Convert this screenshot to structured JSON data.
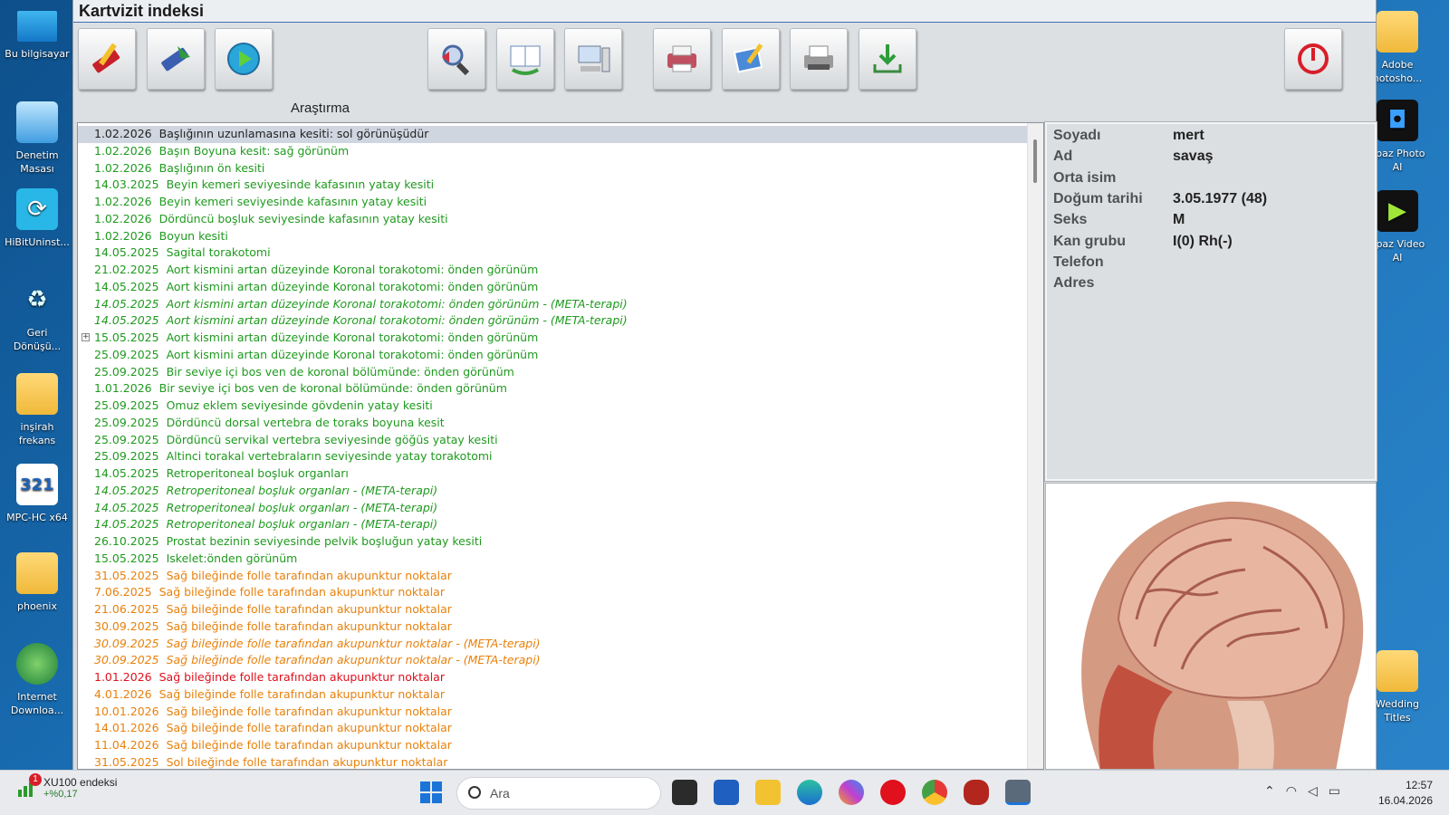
{
  "desktop": {
    "left_icons": [
      {
        "label": "Bu bilgisayar",
        "icon": "monitor-icon"
      },
      {
        "label": "Denetim\nMasası",
        "icon": "control-panel-icon"
      },
      {
        "label": "HiBitUninst...",
        "icon": "uninstaller-icon"
      },
      {
        "label": "Geri\nDönüşü...",
        "icon": "recycle-bin-icon"
      },
      {
        "label": "inşirah\nfrekans",
        "icon": "folder-icon"
      },
      {
        "label": "MPC-HC x64",
        "icon": "media-player-icon"
      },
      {
        "label": "phoenix",
        "icon": "folder-user-icon"
      },
      {
        "label": "Internet\nDownloa...",
        "icon": "downloader-icon"
      }
    ],
    "right_icons": [
      {
        "label": "Adobe\nhotosho...",
        "icon": "folder-photoshop-icon"
      },
      {
        "label": "opaz Photo\nAI",
        "icon": "topaz-photo-icon"
      },
      {
        "label": "opaz Video\nAI",
        "icon": "topaz-video-icon"
      },
      {
        "label": "Wedding\nTitles",
        "icon": "folder-ae-icon"
      }
    ]
  },
  "app": {
    "title": "Kartvizit indeksi",
    "toolbar": {
      "buttons": [
        {
          "name": "edit-button",
          "icon": "pencil-ruler-icon"
        },
        {
          "name": "tools-button",
          "icon": "tools-arrow-icon"
        },
        {
          "name": "research-button",
          "icon": "play-circle-icon"
        },
        {
          "name": "search-button",
          "icon": "magnifier-icon"
        },
        {
          "name": "compare-button",
          "icon": "documents-icon"
        },
        {
          "name": "computer-button",
          "icon": "computer-icon"
        },
        {
          "name": "print-button",
          "icon": "printer-icon"
        },
        {
          "name": "edit-image-button",
          "icon": "image-edit-icon"
        },
        {
          "name": "fax-button",
          "icon": "fax-icon"
        },
        {
          "name": "export-button",
          "icon": "download-tray-icon"
        },
        {
          "name": "power-button",
          "icon": "power-icon"
        }
      ],
      "tooltip": "Araştırma"
    },
    "records": [
      {
        "date": "1.02.2026",
        "text": "Başlığının uzunlamasına kesiti: sol görünüşüdür",
        "color": "selected",
        "italic": false
      },
      {
        "date": "1.02.2026",
        "text": "Başın Boyuna kesit: sağ görünüm",
        "color": "green",
        "italic": false
      },
      {
        "date": "1.02.2026",
        "text": "Başlığının ön kesiti",
        "color": "green",
        "italic": false
      },
      {
        "date": "14.03.2025",
        "text": "Beyin kemeri seviyesinde kafasının yatay kesiti",
        "color": "green",
        "italic": false
      },
      {
        "date": "1.02.2026",
        "text": "Beyin kemeri seviyesinde kafasının yatay kesiti",
        "color": "green",
        "italic": false
      },
      {
        "date": "1.02.2026",
        "text": "Dördüncü boşluk seviyesinde kafasının yatay kesiti",
        "color": "green",
        "italic": false
      },
      {
        "date": "1.02.2026",
        "text": "Boyun kesiti",
        "color": "green",
        "italic": false
      },
      {
        "date": "14.05.2025",
        "text": "Sagital torakotomi",
        "color": "green",
        "italic": false
      },
      {
        "date": "21.02.2025",
        "text": "Aort kismini artan düzeyinde Koronal torakotomi: önden görünüm",
        "color": "green",
        "italic": false
      },
      {
        "date": "14.05.2025",
        "text": "Aort kismini artan düzeyinde Koronal torakotomi: önden görünüm",
        "color": "green",
        "italic": false
      },
      {
        "date": "14.05.2025",
        "text": "Aort kismini artan düzeyinde Koronal torakotomi: önden görünüm - (META-terapi)",
        "color": "green",
        "italic": true
      },
      {
        "date": "14.05.2025",
        "text": "Aort kismini artan düzeyinde Koronal torakotomi: önden görünüm - (META-terapi)",
        "color": "green",
        "italic": true
      },
      {
        "date": "15.05.2025",
        "text": "Aort kismini artan düzeyinde Koronal torakotomi: önden görünüm",
        "color": "green",
        "italic": false,
        "expander": true
      },
      {
        "date": "25.09.2025",
        "text": "Aort kismini artan düzeyinde Koronal torakotomi: önden görünüm",
        "color": "green",
        "italic": false
      },
      {
        "date": "25.09.2025",
        "text": "Bir seviye içi bos ven de koronal bölümünde: önden görünüm",
        "color": "green",
        "italic": false
      },
      {
        "date": "1.01.2026",
        "text": "Bir seviye içi bos ven de koronal bölümünde: önden görünüm",
        "color": "green",
        "italic": false
      },
      {
        "date": "25.09.2025",
        "text": "Omuz eklem seviyesinde gövdenin yatay kesiti",
        "color": "green",
        "italic": false
      },
      {
        "date": "25.09.2025",
        "text": "Dördüncü dorsal vertebra de toraks boyuna kesit",
        "color": "green",
        "italic": false
      },
      {
        "date": "25.09.2025",
        "text": "Dördüncü servikal vertebra seviyesinde göğüs yatay kesiti",
        "color": "green",
        "italic": false
      },
      {
        "date": "25.09.2025",
        "text": "Altinci torakal vertebraların seviyesinde yatay torakotomi",
        "color": "green",
        "italic": false
      },
      {
        "date": "14.05.2025",
        "text": "Retroperitoneal boşluk organları",
        "color": "green",
        "italic": false
      },
      {
        "date": "14.05.2025",
        "text": "Retroperitoneal boşluk organları - (META-terapi)",
        "color": "green",
        "italic": true
      },
      {
        "date": "14.05.2025",
        "text": "Retroperitoneal boşluk organları - (META-terapi)",
        "color": "green",
        "italic": true
      },
      {
        "date": "14.05.2025",
        "text": "Retroperitoneal boşluk organları - (META-terapi)",
        "color": "green",
        "italic": true
      },
      {
        "date": "26.10.2025",
        "text": "Prostat bezinin seviyesinde pelvik boşluğun yatay kesiti",
        "color": "green",
        "italic": false
      },
      {
        "date": "15.05.2025",
        "text": "Iskelet:önden görünüm",
        "color": "green",
        "italic": false
      },
      {
        "date": "31.05.2025",
        "text": "Sağ bileğinde folle tarafından akupunktur noktalar",
        "color": "orange",
        "italic": false
      },
      {
        "date": "7.06.2025",
        "text": "Sağ bileğinde folle tarafından akupunktur noktalar",
        "color": "orange",
        "italic": false
      },
      {
        "date": "21.06.2025",
        "text": "Sağ bileğinde folle tarafından akupunktur noktalar",
        "color": "orange",
        "italic": false
      },
      {
        "date": "30.09.2025",
        "text": "Sağ bileğinde folle tarafından akupunktur noktalar",
        "color": "orange",
        "italic": false
      },
      {
        "date": "30.09.2025",
        "text": "Sağ bileğinde folle tarafından akupunktur noktalar - (META-terapi)",
        "color": "orange",
        "italic": true
      },
      {
        "date": "30.09.2025",
        "text": "Sağ bileğinde folle tarafından akupunktur noktalar - (META-terapi)",
        "color": "orange",
        "italic": true
      },
      {
        "date": "1.01.2026",
        "text": "Sağ bileğinde folle tarafından akupunktur noktalar",
        "color": "red",
        "italic": false
      },
      {
        "date": "4.01.2026",
        "text": "Sağ bileğinde folle tarafından akupunktur noktalar",
        "color": "orange",
        "italic": false
      },
      {
        "date": "10.01.2026",
        "text": "Sağ bileğinde folle tarafından akupunktur noktalar",
        "color": "orange",
        "italic": false
      },
      {
        "date": "14.01.2026",
        "text": "Sağ bileğinde folle tarafından akupunktur noktalar",
        "color": "orange",
        "italic": false
      },
      {
        "date": "11.04.2026",
        "text": "Sağ bileğinde folle tarafından akupunktur noktalar",
        "color": "orange",
        "italic": false
      },
      {
        "date": "31.05.2025",
        "text": "Sol bileğinde folle tarafından akupunktur noktalar",
        "color": "orange",
        "italic": false
      }
    ],
    "patient": {
      "fields": [
        {
          "label": "Soyadı",
          "value": "mert"
        },
        {
          "label": "Ad",
          "value": "savaş"
        },
        {
          "label": "Orta isim",
          "value": ""
        },
        {
          "label": "Doğum tarihi",
          "value": "3.05.1977 (48)"
        },
        {
          "label": "Seks",
          "value": "M"
        },
        {
          "label": "Kan grubu",
          "value": "I(0)  Rh(-)"
        },
        {
          "label": "Telefon",
          "value": ""
        },
        {
          "label": "Adres",
          "value": ""
        }
      ]
    },
    "preview_image": "head-sagittal-section-image"
  },
  "taskbar": {
    "widget_title": "XU100 endeksi",
    "widget_sub": "+%0,17",
    "widget_badge": "1",
    "search_placeholder": "Ara",
    "time": "12:57",
    "date": "16.04.2026"
  }
}
